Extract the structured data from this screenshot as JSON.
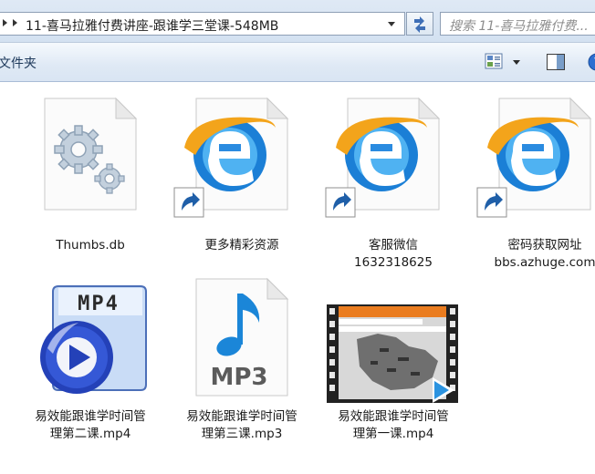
{
  "address_bar": {
    "path": "11-喜马拉雅付费讲座-跟谁学三堂课-548MB",
    "search_placeholder": "搜索 11-喜马拉雅付费..."
  },
  "toolbar": {
    "new_folder_label": "文件夹"
  },
  "files": [
    {
      "line1": "Thumbs.db",
      "line2": "",
      "icon": "settings-file-icon"
    },
    {
      "line1": "更多精彩资源",
      "line2": "",
      "icon": "ie-shortcut-icon"
    },
    {
      "line1": "客服微信",
      "line2": "1632318625",
      "icon": "ie-shortcut-icon"
    },
    {
      "line1": "密码获取网址",
      "line2": "bbs.azhuge.com",
      "icon": "ie-shortcut-icon"
    },
    {
      "line1": "易效能跟谁学时间管",
      "line2": "理第二课.mp4",
      "icon": "mp4-file-icon"
    },
    {
      "line1": "易效能跟谁学时间管",
      "line2": "理第三课.mp3",
      "icon": "mp3-file-icon"
    },
    {
      "line1": "易效能跟谁学时间管",
      "line2": "理第一课.mp4",
      "icon": "video-thumbnail-icon"
    }
  ],
  "icon_text": {
    "mp4_badge": "MP4",
    "mp3_badge": "MP3"
  },
  "colors": {
    "toolbar_bg": "#dfe9f5",
    "ie_blue": "#1b7fd6",
    "ie_orange": "#f3a41b",
    "mp4_blue": "#2441b8"
  }
}
